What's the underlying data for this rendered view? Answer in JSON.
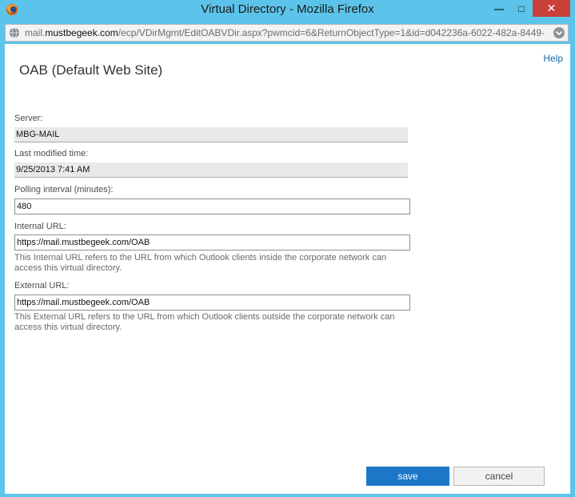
{
  "window": {
    "title": "Virtual Directory - Mozilla Firefox",
    "minimize": "—",
    "maximize": "□",
    "close": "✕"
  },
  "address_bar": {
    "url_prefix": "mail.",
    "url_domain": "mustbegeek.com",
    "url_path": "/ecp/VDirMgmt/EditOABVDir.aspx?pwmcid=6&ReturnObjectType=1&id=d042236a-6022-482a-8449-"
  },
  "page": {
    "help_link": "Help",
    "title": "OAB (Default Web Site)"
  },
  "form": {
    "server_label": "Server:",
    "server_value": "MBG-MAIL",
    "modified_label": "Last modified time:",
    "modified_value": "9/25/2013 7:41 AM",
    "polling_label": "Polling interval (minutes):",
    "polling_value": "480",
    "internal_label": "Internal URL:",
    "internal_value": "https://mail.mustbegeek.com/OAB",
    "internal_help": "This Internal URL refers to the URL from which Outlook clients inside the corporate network can access this virtual directory.",
    "external_label": "External URL:",
    "external_value": "https://mail.mustbegeek.com/OAB",
    "external_help": "This External URL refers to the URL from which Outlook clients outside the corporate network can access this virtual directory."
  },
  "buttons": {
    "save": "save",
    "cancel": "cancel"
  },
  "colors": {
    "titlebar": "#5cc4ea",
    "close_button": "#c9403a",
    "save_button": "#1d77c9",
    "link": "#1f6aa8"
  },
  "icons": {
    "app": "firefox-icon",
    "address": "globe-icon",
    "dropdown": "chevron-down-icon"
  }
}
